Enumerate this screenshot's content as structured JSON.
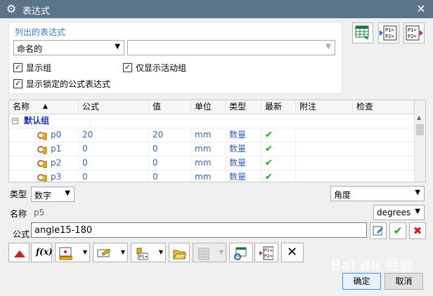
{
  "window": {
    "title": "表达式",
    "close": "✕"
  },
  "list_section": {
    "title": "列出的表达式",
    "filter_value": "命名的",
    "filter_text": "",
    "show_groups": "显示组",
    "show_active_only": "仅显示活动组",
    "show_locked": "显示锁定的公式表达式"
  },
  "table": {
    "columns": [
      "名称",
      "公式",
      "值",
      "单位",
      "类型",
      "最新",
      "附注",
      "检查"
    ],
    "sort_indicator": "▲",
    "group": "默认组",
    "rows": [
      {
        "name": "p0",
        "formula": "20",
        "value": "20",
        "unit": "mm",
        "type": "数量"
      },
      {
        "name": "p1",
        "formula": "0",
        "value": "0",
        "unit": "mm",
        "type": "数量"
      },
      {
        "name": "p2",
        "formula": "0",
        "value": "0",
        "unit": "mm",
        "type": "数量"
      },
      {
        "name": "p3",
        "formula": "0",
        "value": "0",
        "unit": "mm",
        "type": "数量"
      }
    ]
  },
  "editor": {
    "type_label": "类型",
    "type_value": "数字",
    "dimension_value": "角度",
    "name_label": "名称",
    "name_value": "p5",
    "unit_value": "degrees",
    "formula_label": "公式",
    "formula_value": "angle15-180"
  },
  "buttons": {
    "ok": "确定",
    "cancel": "取消"
  },
  "watermark": "Bai du 经验",
  "colors": {
    "titlebar": "#5b7487",
    "accent": "#3a78c6",
    "link": "#3a62b8"
  }
}
